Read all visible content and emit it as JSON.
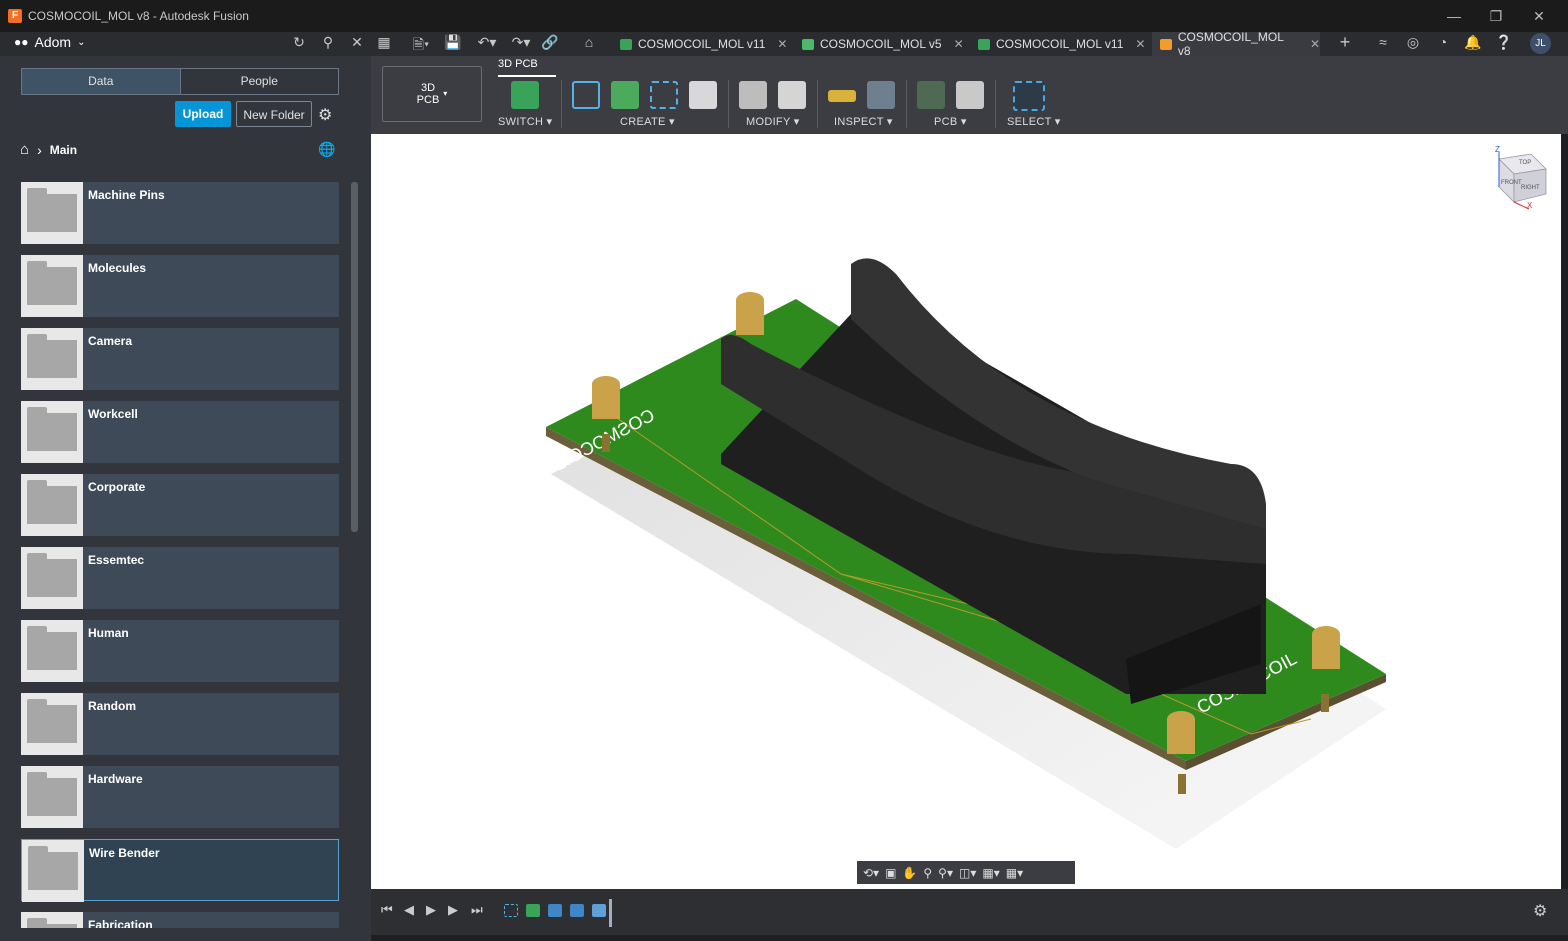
{
  "window": {
    "title": "COSMOCOIL_MOL v8 - Autodesk Fusion"
  },
  "appbar": {
    "team": "Adom",
    "tabs": [
      {
        "label": "COSMOCOIL_MOL v11",
        "icon": "pcb-tab-icon"
      },
      {
        "label": "COSMOCOIL_MOL v5",
        "icon": "schematic-tab-icon"
      },
      {
        "label": "COSMOCOIL_MOL v11",
        "icon": "pcb-tab-icon"
      },
      {
        "label": "COSMOCOIL_MOL v8",
        "icon": "3d-pcb-tab-icon"
      }
    ],
    "user_initials": "JL"
  },
  "data_panel": {
    "segments": [
      "Data",
      "People"
    ],
    "upload": "Upload",
    "new_folder": "New Folder",
    "breadcrumb": "Main",
    "folders": [
      "Machine Pins",
      "Molecules",
      "Camera",
      "Workcell",
      "Corporate",
      "Essemtec",
      "Human",
      "Random",
      "Hardware",
      "Wire Bender",
      "Fabrication"
    ],
    "selected_folder": "Wire Bender"
  },
  "toolbar": {
    "workspace": "3D PCB",
    "workspace_line1": "3D",
    "workspace_line2": "PCB",
    "tab": "3D PCB",
    "groups": {
      "switch": "SWITCH ▾",
      "create": "CREATE ▾",
      "modify": "MODIFY ▾",
      "inspect": "INSPECT ▾",
      "pcb": "PCB ▾",
      "select": "SELECT ▾"
    }
  },
  "viewport": {
    "silk_text": "COSMOCOIL",
    "viewcube_labels": {
      "top": "TOP",
      "front": "FRONT",
      "right": "RIGHT"
    },
    "axes": {
      "z": "Z",
      "x": "X"
    }
  },
  "colors": {
    "accent": "#0696d7",
    "pcb_green": "#2f8a1e",
    "holder": "#2a2a2a",
    "brass": "#c9a24a"
  }
}
